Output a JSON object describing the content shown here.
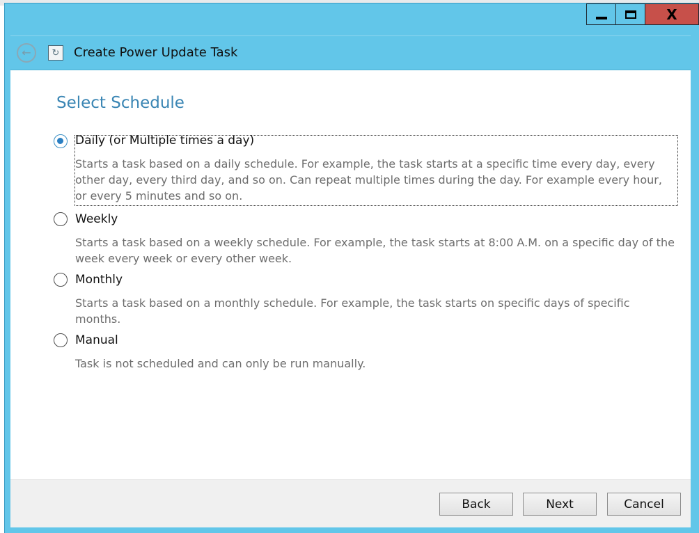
{
  "window": {
    "title": "Create Power Update Task",
    "close_glyph": "X"
  },
  "icons": {
    "back": "back-arrow-icon",
    "app": "power-update-icon",
    "minimize": "minimize-icon",
    "maximize": "maximize-icon",
    "close": "close-icon"
  },
  "page": {
    "heading": "Select Schedule"
  },
  "options": [
    {
      "label": "Daily (or Multiple times a day)",
      "description": "Starts a task based on a daily schedule. For example, the task starts at a specific time every day, every other day, every third day, and so on. Can repeat multiple times during the day. For example every hour, or every 5 minutes and so on.",
      "selected": true
    },
    {
      "label": "Weekly",
      "description": "Starts a task based on a weekly schedule. For example, the task starts at 8:00 A.M. on a specific day of the week every week or every other week.",
      "selected": false
    },
    {
      "label": "Monthly",
      "description": "Starts a task based on a monthly schedule. For example, the task starts on specific days of specific months.",
      "selected": false
    },
    {
      "label": "Manual",
      "description": "Task is not scheduled and can only be run manually.",
      "selected": false
    }
  ],
  "buttons": {
    "back": "Back",
    "next": "Next",
    "cancel": "Cancel"
  },
  "colors": {
    "frame": "#62c6e9",
    "heading": "#3b86b4",
    "close_button": "#c7504a",
    "radio_selected": "#2b7fc2"
  }
}
